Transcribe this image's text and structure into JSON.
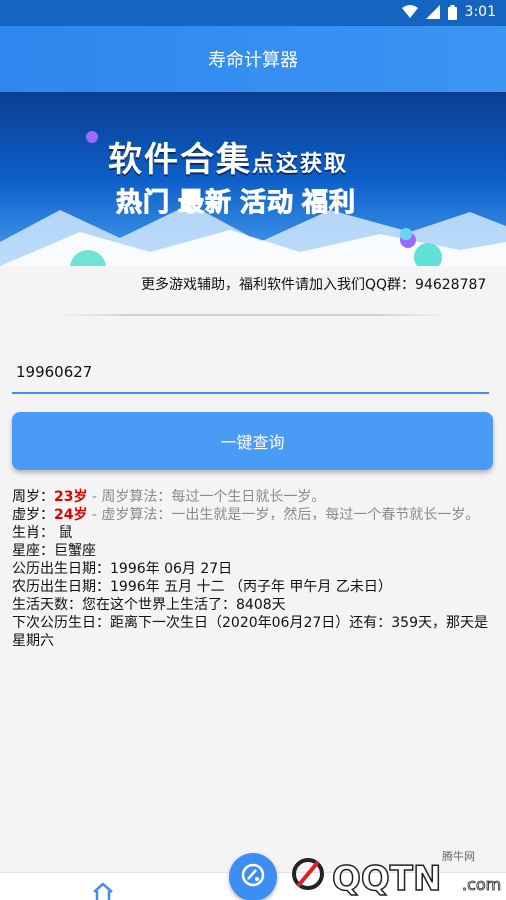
{
  "status_bar": {
    "time": "3:01"
  },
  "header": {
    "title": "寿命计算器"
  },
  "banner": {
    "line1_big": "软件合集",
    "line1_small": "点这获取",
    "line2": [
      {
        "text": "热门",
        "color": "#ff2a2a"
      },
      {
        "text": "最新",
        "color": "#7ee33a"
      },
      {
        "text": "活动",
        "color": "#7ee33a"
      },
      {
        "text": "福利",
        "color": "#ffb400"
      }
    ]
  },
  "marquee": {
    "text": "更多游戏辅助，福利软件请加入我们QQ群：94628787"
  },
  "date_input": {
    "value": "19960627"
  },
  "query_button": {
    "label": "一键查询"
  },
  "results": {
    "zhousui": {
      "label": "周岁：",
      "value": "23岁",
      "desc": " - 周岁算法：每过一个生日就长一岁。"
    },
    "xusui": {
      "label": "虚岁：",
      "value": "24岁",
      "desc": " - 虚岁算法：一出生就是一岁，然后，每过一个春节就长一岁。"
    },
    "shengxiao": "生肖：  鼠",
    "xingzuo": "星座：巨蟹座",
    "gongli": "公历出生日期：1996年 06月 27日",
    "nongli": "农历出生日期：1996年 五月 十二 （丙子年 甲午月 乙未日）",
    "days": "生活天数：您在这个世界上生活了：8408天",
    "next_birthday": "下次公历生日：距离下一次生日（2020年06月27日）还有：359天，那天是星期六"
  },
  "watermark": {
    "brand": "QQTN.com",
    "small": "腾牛网"
  },
  "icons": [
    "wifi-icon",
    "signal-icon",
    "battery-icon",
    "home-icon",
    "fab-icon"
  ],
  "colors": {
    "header": "#3b95f3",
    "button": "#4a9bf6",
    "age_red": "#e00000",
    "desc_gray": "#8a8a8a"
  }
}
